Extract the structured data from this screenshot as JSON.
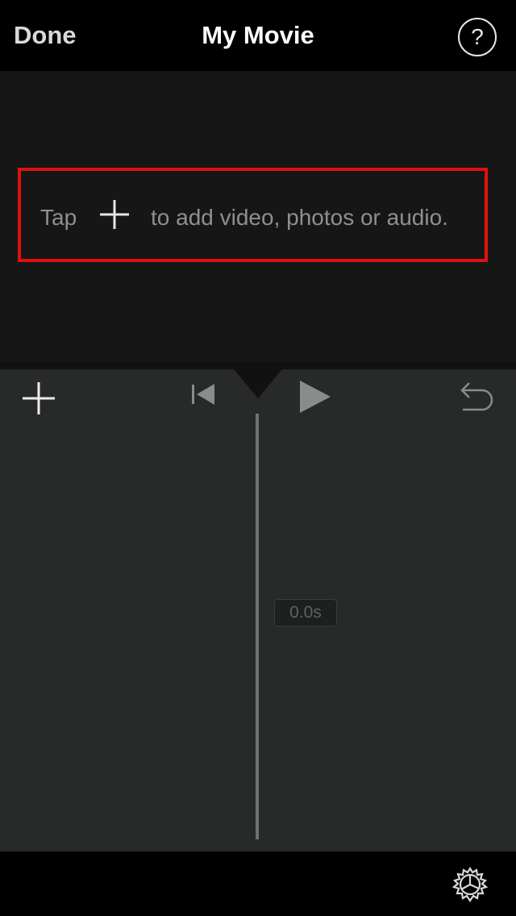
{
  "nav": {
    "done_label": "Done",
    "title": "My Movie",
    "help_label": "?"
  },
  "viewer": {
    "hint_tap": "Tap",
    "hint_rest": "to add video, photos or audio."
  },
  "timeline": {
    "duration": "0.0s"
  },
  "icons": {
    "hint_plus": "plus-icon",
    "add": "plus-icon",
    "skip_back": "skip-to-start-icon",
    "play": "play-icon",
    "undo": "undo-icon",
    "settings": "gear-icon"
  },
  "colors": {
    "highlight_border": "#e0100f",
    "editor_bg": "#282a2a",
    "viewer_bg": "#161616"
  }
}
